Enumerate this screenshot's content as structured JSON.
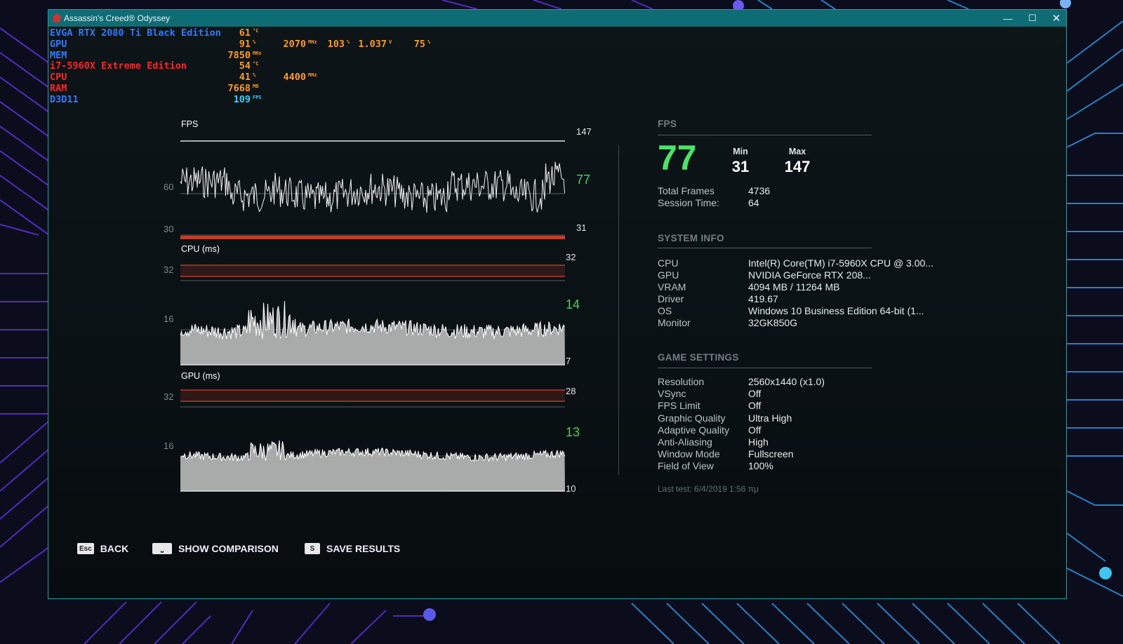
{
  "window": {
    "title": "Assassin's Creed® Odyssey"
  },
  "osd": [
    {
      "label": "EVGA RTX 2080 Ti Black Edition",
      "color": "#2f7bff",
      "values": [
        {
          "v": "61",
          "u": "°C",
          "color": "#ff9b1a"
        }
      ]
    },
    {
      "label": "GPU",
      "color": "#2f7bff",
      "values": [
        {
          "v": "91",
          "u": "%",
          "color": "#ff9b1a"
        },
        {
          "v": "2070",
          "u": "MHz",
          "color": "#ff9b1a"
        },
        {
          "v": "103",
          "u": "%",
          "color": "#ff9b1a"
        },
        {
          "v": "1.037",
          "u": "V",
          "color": "#ff9b1a"
        },
        {
          "v": "75",
          "u": "%",
          "color": "#ff9b1a"
        }
      ]
    },
    {
      "label": "MEM",
      "color": "#2f7bff",
      "values": [
        {
          "v": "7850",
          "u": "MHz",
          "color": "#ff9b1a"
        }
      ]
    },
    {
      "label": "i7-5960X Extreme Edition",
      "color": "#ff2424",
      "values": [
        {
          "v": "54",
          "u": "°C",
          "color": "#ff9b1a"
        }
      ]
    },
    {
      "label": "CPU",
      "color": "#ff2424",
      "values": [
        {
          "v": "41",
          "u": "%",
          "color": "#ff9b1a"
        },
        {
          "v": "4400",
          "u": "MHz",
          "color": "#ff9b1a"
        }
      ]
    },
    {
      "label": "RAM",
      "color": "#ff2424",
      "values": [
        {
          "v": "7668",
          "u": "MB",
          "color": "#ff9b1a"
        }
      ]
    },
    {
      "label": "D3D11",
      "color": "#2f7bff",
      "values": [
        {
          "v": "109",
          "u": "FPS",
          "color": "#33d1ff"
        }
      ]
    }
  ],
  "graphs": {
    "fps": {
      "title": "FPS",
      "axis": [
        "60",
        "30"
      ],
      "max": "147",
      "current": "77",
      "min": "31"
    },
    "cpu": {
      "title": "CPU (ms)",
      "axis": [
        "32",
        "16"
      ],
      "top": "32",
      "current": "14",
      "bottom": "7"
    },
    "gpu": {
      "title": "GPU (ms)",
      "axis": [
        "32",
        "16"
      ],
      "top": "28",
      "current": "13",
      "bottom": "10"
    }
  },
  "fps_panel": {
    "title": "FPS",
    "current": "77",
    "min_label": "Min",
    "min": "31",
    "max_label": "Max",
    "max": "147",
    "total_frames_label": "Total Frames",
    "total_frames": "4736",
    "session_time_label": "Session Time:",
    "session_time": "64"
  },
  "system_info": {
    "title": "SYSTEM INFO",
    "rows": [
      {
        "label": "CPU",
        "value": "Intel(R) Core(TM) i7-5960X CPU @ 3.00..."
      },
      {
        "label": "GPU",
        "value": "NVIDIA GeForce RTX 208..."
      },
      {
        "label": "VRAM",
        "value": "4094 MB / 11264 MB"
      },
      {
        "label": "Driver",
        "value": "419.67"
      },
      {
        "label": "OS",
        "value": "Windows 10 Business Edition 64-bit (1..."
      },
      {
        "label": "Monitor",
        "value": "32GK850G"
      }
    ]
  },
  "game_settings": {
    "title": "GAME SETTINGS",
    "rows": [
      {
        "label": "Resolution",
        "value": "2560x1440 (x1.0)"
      },
      {
        "label": "VSync",
        "value": "Off"
      },
      {
        "label": "FPS Limit",
        "value": "Off"
      },
      {
        "label": "Graphic Quality",
        "value": "Ultra High"
      },
      {
        "label": "Adaptive Quality",
        "value": "Off"
      },
      {
        "label": "Anti-Aliasing",
        "value": "High"
      },
      {
        "label": "Window Mode",
        "value": "Fullscreen"
      },
      {
        "label": "Field of View",
        "value": "100%"
      }
    ],
    "last_test": "Last test: 6/4/2019 1:56 πμ"
  },
  "prompts": {
    "back_key": "Esc",
    "back": "BACK",
    "compare": "SHOW COMPARISON",
    "save_key": "S",
    "save": "SAVE RESULTS"
  },
  "colors": {
    "accent_green": "#49d25f",
    "title_bar": "#0e6c74",
    "limit_red": "#d8432c"
  }
}
